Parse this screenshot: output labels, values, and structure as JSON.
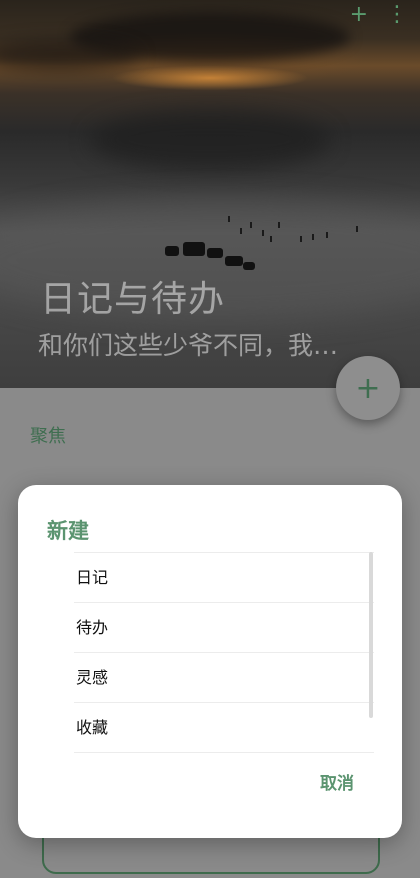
{
  "header": {
    "title": "日记与待办",
    "subtitle": "和你们这些少爷不同，我…",
    "icons": [
      "plus-icon",
      "more-vert-icon"
    ]
  },
  "fab": {
    "icon": "plus-icon",
    "label": "+"
  },
  "main": {
    "section_label": "聚焦"
  },
  "dialog": {
    "title": "新建",
    "options": [
      "日记",
      "待办",
      "灵感",
      "收藏"
    ],
    "cancel_label": "取消"
  },
  "colors": {
    "accent": "#5b9470",
    "scrim": "#8a8a8a",
    "dialog_bg": "#ffffff"
  }
}
